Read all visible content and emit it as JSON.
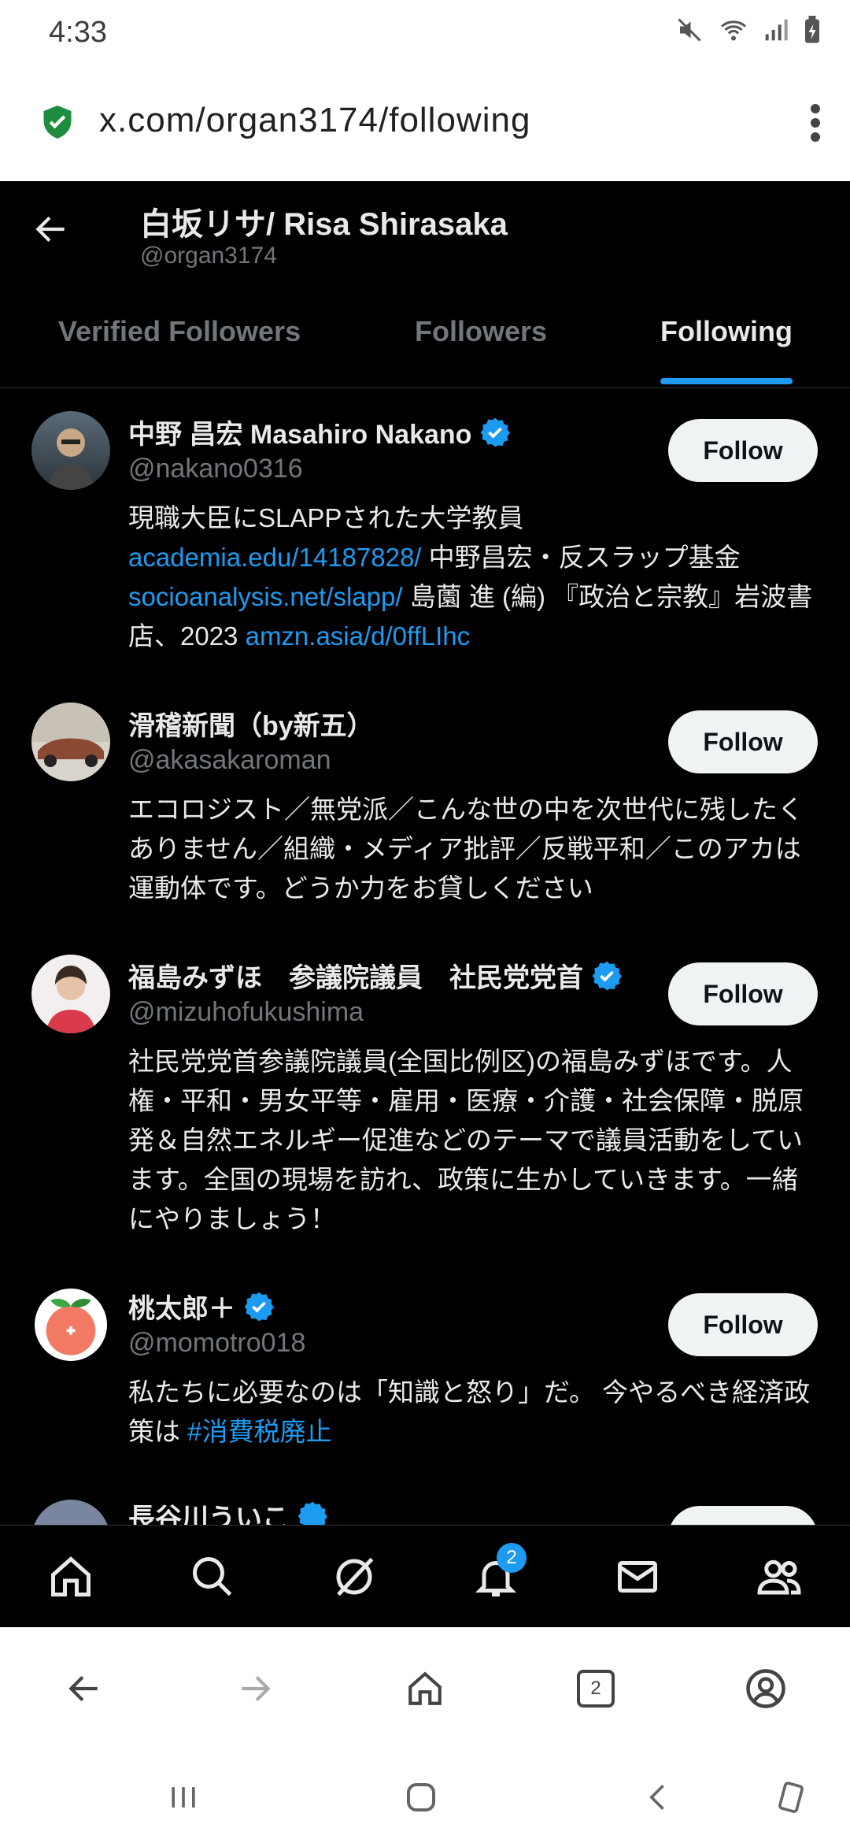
{
  "status_bar": {
    "time": "4:33"
  },
  "url_bar": {
    "url": "x.com/organ3174/following"
  },
  "profile": {
    "name": "白坂リサ/ Risa Shirasaka",
    "handle": "@organ3174"
  },
  "tabs": [
    {
      "label": "Verified Followers"
    },
    {
      "label": "Followers"
    },
    {
      "label": "Following"
    }
  ],
  "users": [
    {
      "name": "中野 昌宏 Masahiro Nakano",
      "handle": "@nakano0316",
      "follow_label": "Follow",
      "bio_1": "現職大臣にSLAPPされた大学教員",
      "bio_link_1": "academia.edu/14187828/",
      "bio_2": " 中野昌宏・反スラップ基金",
      "bio_link_2": "socioanalysis.net/slapp/",
      "bio_3": " 島薗 進 (編) 『政治と宗教』岩波書店、2023 ",
      "bio_link_3": "amzn.asia/d/0ffLIhc"
    },
    {
      "name": "滑稽新聞（by新五）",
      "handle": "@akasakaroman",
      "follow_label": "Follow",
      "bio": "エコロジスト／無党派／こんな世の中を次世代に残したくありません／組織・メディア批評／反戦平和／このアカは運動体です。どうか力をお貸しください"
    },
    {
      "name": "福島みずほ　参議院議員　社民党党首",
      "handle": "@mizuhofukushima",
      "follow_label": "Follow",
      "bio": "社民党党首参議院議員(全国比例区)の福島みずほです。人権・平和・男女平等・雇用・医療・介護・社会保障・脱原発＆自然エネルギー促進などのテーマで議員活動をしています。全国の現場を訪れ、政策に生かしていきます。一緒にやりましょう！"
    },
    {
      "name": "桃太郎＋",
      "handle": "@momotro018",
      "follow_label": "Follow",
      "bio": "私たちに必要なのは「知識と怒り」だ。 今やるべき経済政策は ",
      "bio_tag": "#消費税廃止"
    },
    {
      "name": "長谷川ういこ"
    }
  ],
  "nav": {
    "notifications_badge": "2"
  },
  "browser_bar": {
    "tab_count": "2"
  },
  "colors": {
    "accent": "#1d9bf0",
    "background": "#000000"
  }
}
